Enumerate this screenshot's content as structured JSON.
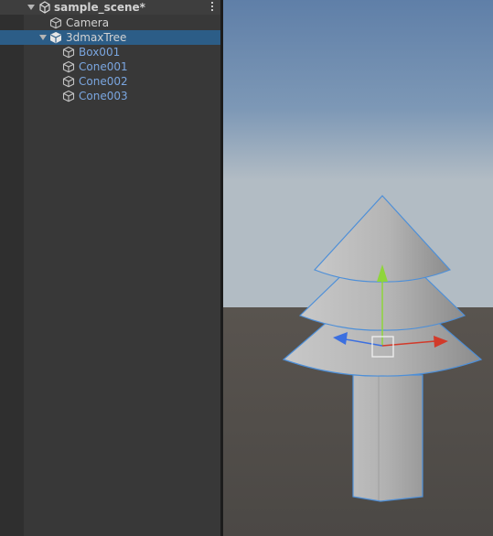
{
  "hierarchy": {
    "scene_name": "sample_scene*",
    "items": [
      {
        "label": "Camera"
      },
      {
        "label": "3dmaxTree"
      },
      {
        "label": "Box001"
      },
      {
        "label": "Cone001"
      },
      {
        "label": "Cone002"
      },
      {
        "label": "Cone003"
      }
    ]
  },
  "colors": {
    "selection": "#2c5d87",
    "prefab_text": "#7aa6e0",
    "gizmo_x": "#d23a2a",
    "gizmo_y": "#8fd53a",
    "gizmo_z": "#3b6fe0",
    "outline": "#4d8fd8"
  },
  "icons": [
    "unity-scene-icon",
    "kebab-menu-icon",
    "gameobject-cube-icon",
    "prefab-cube-icon"
  ]
}
